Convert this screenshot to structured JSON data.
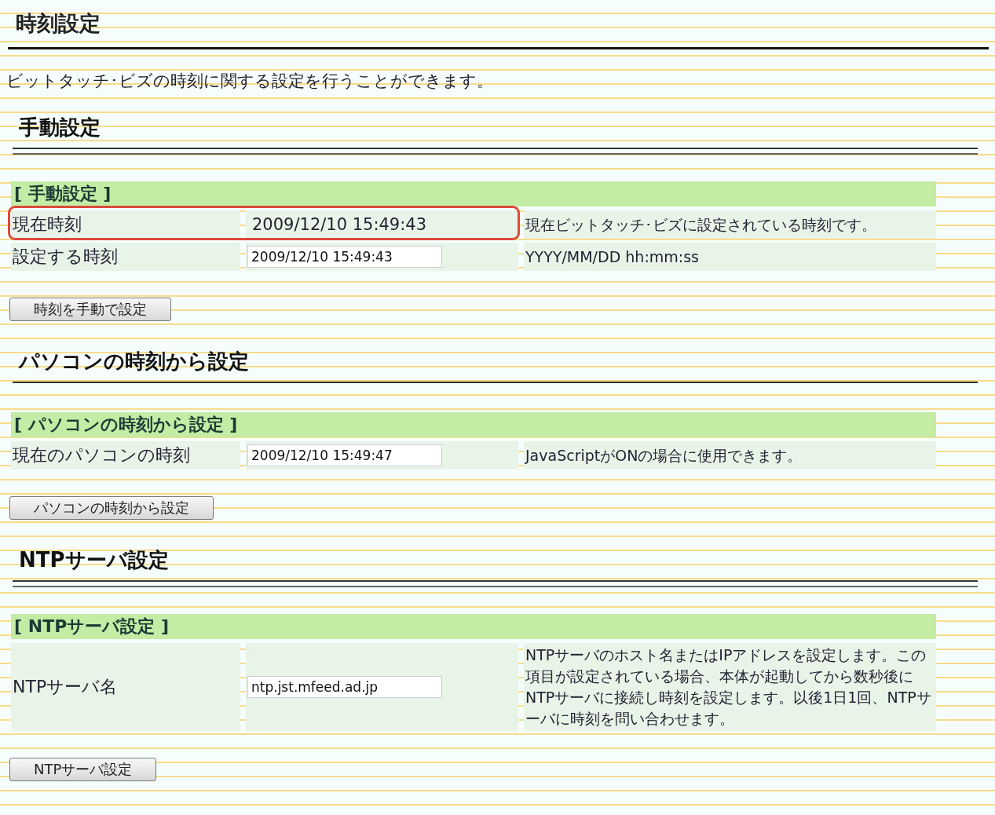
{
  "page": {
    "title": "時刻設定",
    "intro": "ビットタッチ･ビズの時刻に関する設定を行うことができます。"
  },
  "sections": [
    {
      "heading": "手動設定",
      "double_rule": true,
      "table_title": "[ 手動設定 ]",
      "rows": [
        {
          "label": "現在時刻",
          "kind": "text",
          "value": "2009/12/10 15:49:43",
          "description": "現在ビットタッチ･ビズに設定されている時刻です。",
          "highlighted": true
        },
        {
          "label": "設定する時刻",
          "kind": "input",
          "value": "2009/12/10 15:49:43",
          "description": "YYYY/MM/DD hh:mm:ss",
          "highlighted": false
        }
      ],
      "button": "時刻を手動で設定"
    },
    {
      "heading": "パソコンの時刻から設定",
      "double_rule": false,
      "table_title": "[ パソコンの時刻から設定 ]",
      "rows": [
        {
          "label": "現在のパソコンの時刻",
          "kind": "input",
          "value": "2009/12/10 15:49:47",
          "description": "JavaScriptがONの場合に使用できます。",
          "highlighted": false
        }
      ],
      "button": "パソコンの時刻から設定"
    },
    {
      "heading": "NTPサーバ設定",
      "double_rule": true,
      "table_title": "[ NTPサーバ設定 ]",
      "rows": [
        {
          "label": "NTPサーバ名",
          "kind": "input",
          "value": "ntp.jst.mfeed.ad.jp",
          "description": "NTPサーバのホスト名またはIPアドレスを設定します。この項目が設定されている場合、本体が起動してから数秒後にNTPサーバに接続し時刻を設定します。以後1日1回、NTPサーバに時刻を問い合わせます。",
          "highlighted": false
        }
      ],
      "button": "NTPサーバ設定"
    }
  ]
}
